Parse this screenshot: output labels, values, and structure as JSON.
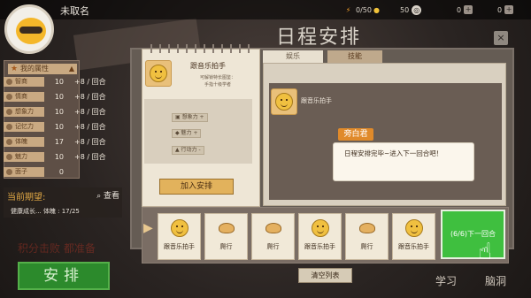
{
  "topbar": {
    "player_name": "未取名",
    "energy": "0/50",
    "coins": "50",
    "gems": "0",
    "tickets": "0",
    "colors": {
      "energy": "#f4a12a",
      "coin": "#f2c33a",
      "gem": "#d9d2c8"
    }
  },
  "attributes": {
    "title": "我的属性",
    "items": [
      {
        "label": "智商",
        "value": "10",
        "inc": "+8 / 回合"
      },
      {
        "label": "情商",
        "value": "10",
        "inc": "+8 / 回合"
      },
      {
        "label": "想象力",
        "value": "10",
        "inc": "+8 / 回合"
      },
      {
        "label": "记忆力",
        "value": "10",
        "inc": "+8 / 回合"
      },
      {
        "label": "体魄",
        "value": "17",
        "inc": "+8 / 回合"
      },
      {
        "label": "魅力",
        "value": "10",
        "inc": "+8 / 回合"
      },
      {
        "label": "面子",
        "value": "0",
        "inc": ""
      }
    ]
  },
  "expectation": {
    "title": "当前期望:",
    "link": "查看",
    "text": "健康成长... 体魄 : 17/25"
  },
  "faded_label": "积分击败 都准备",
  "schedule_button": "安排",
  "dialog": {
    "title": "日程安排",
    "close": "×",
    "card": {
      "name": "跟音乐拍手",
      "desc": "可解锁特长图鉴：\n手指十级学者",
      "stats": [
        "想象力 +",
        "魅力 +",
        "行动力 -"
      ],
      "join_button": "加入安排"
    },
    "tabs": [
      "娱乐",
      "技能"
    ],
    "list_item_label": "跟音乐拍手",
    "narrator": {
      "name": "旁白君",
      "text": "日程安排完毕~进入下一回合吧！"
    },
    "slots": [
      {
        "label": "跟音乐拍手",
        "icon": "smile-icon"
      },
      {
        "label": "爬行",
        "icon": "crawl-icon"
      },
      {
        "label": "爬行",
        "icon": "crawl-icon"
      },
      {
        "label": "跟音乐拍手",
        "icon": "smile-icon"
      },
      {
        "label": "爬行",
        "icon": "crawl-icon"
      },
      {
        "label": "跟音乐拍手",
        "icon": "smile-icon"
      }
    ],
    "next_button": "(6/6)下一回合",
    "clear_button": "清空列表"
  },
  "side_labels": [
    "学习",
    "脑洞"
  ]
}
